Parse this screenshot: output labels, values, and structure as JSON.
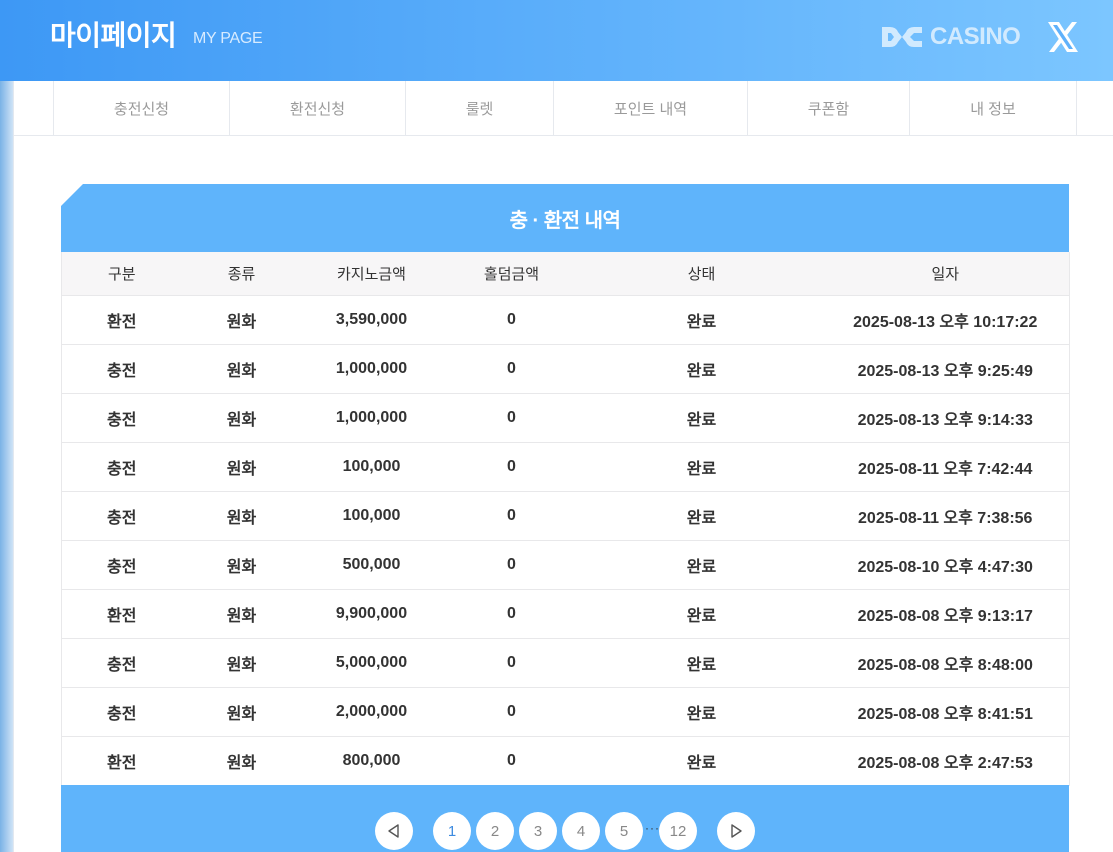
{
  "header": {
    "title": "마이페이지",
    "subtitle": "MY PAGE",
    "logo_text": "CASINO",
    "logo_icon": "dc-logo-icon",
    "close_icon": "x-close-icon"
  },
  "tabs": [
    {
      "label": "충전신청"
    },
    {
      "label": "환전신청"
    },
    {
      "label": "룰렛"
    },
    {
      "label": "포인트 내역"
    },
    {
      "label": "쿠폰함"
    },
    {
      "label": "내 정보"
    }
  ],
  "panel": {
    "title": "충 · 환전 내역",
    "columns": [
      "구분",
      "종류",
      "카지노금액",
      "홀덤금액",
      "상태",
      "일자"
    ],
    "rows": [
      [
        "환전",
        "원화",
        "3,590,000",
        "0",
        "완료",
        "2025-08-13 오후 10:17:22"
      ],
      [
        "충전",
        "원화",
        "1,000,000",
        "0",
        "완료",
        "2025-08-13 오후 9:25:49"
      ],
      [
        "충전",
        "원화",
        "1,000,000",
        "0",
        "완료",
        "2025-08-13 오후 9:14:33"
      ],
      [
        "충전",
        "원화",
        "100,000",
        "0",
        "완료",
        "2025-08-11 오후 7:42:44"
      ],
      [
        "충전",
        "원화",
        "100,000",
        "0",
        "완료",
        "2025-08-11 오후 7:38:56"
      ],
      [
        "충전",
        "원화",
        "500,000",
        "0",
        "완료",
        "2025-08-10 오후 4:47:30"
      ],
      [
        "환전",
        "원화",
        "9,900,000",
        "0",
        "완료",
        "2025-08-08 오후 9:13:17"
      ],
      [
        "충전",
        "원화",
        "5,000,000",
        "0",
        "완료",
        "2025-08-08 오후 8:48:00"
      ],
      [
        "충전",
        "원화",
        "2,000,000",
        "0",
        "완료",
        "2025-08-08 오후 8:41:51"
      ],
      [
        "환전",
        "원화",
        "800,000",
        "0",
        "완료",
        "2025-08-08 오후 2:47:53"
      ]
    ]
  },
  "pagination": {
    "prev_icon": "triangle-left-icon",
    "next_icon": "triangle-right-icon",
    "pages": [
      "1",
      "2",
      "3",
      "4",
      "5"
    ],
    "ellipsis": "···",
    "last_page": "12",
    "active_page": "1"
  },
  "colors": {
    "header_start": "#3d98f5",
    "header_end": "#7cc6ff",
    "panel_blue": "#5fb4fb",
    "active_page": "#3d8be0"
  }
}
